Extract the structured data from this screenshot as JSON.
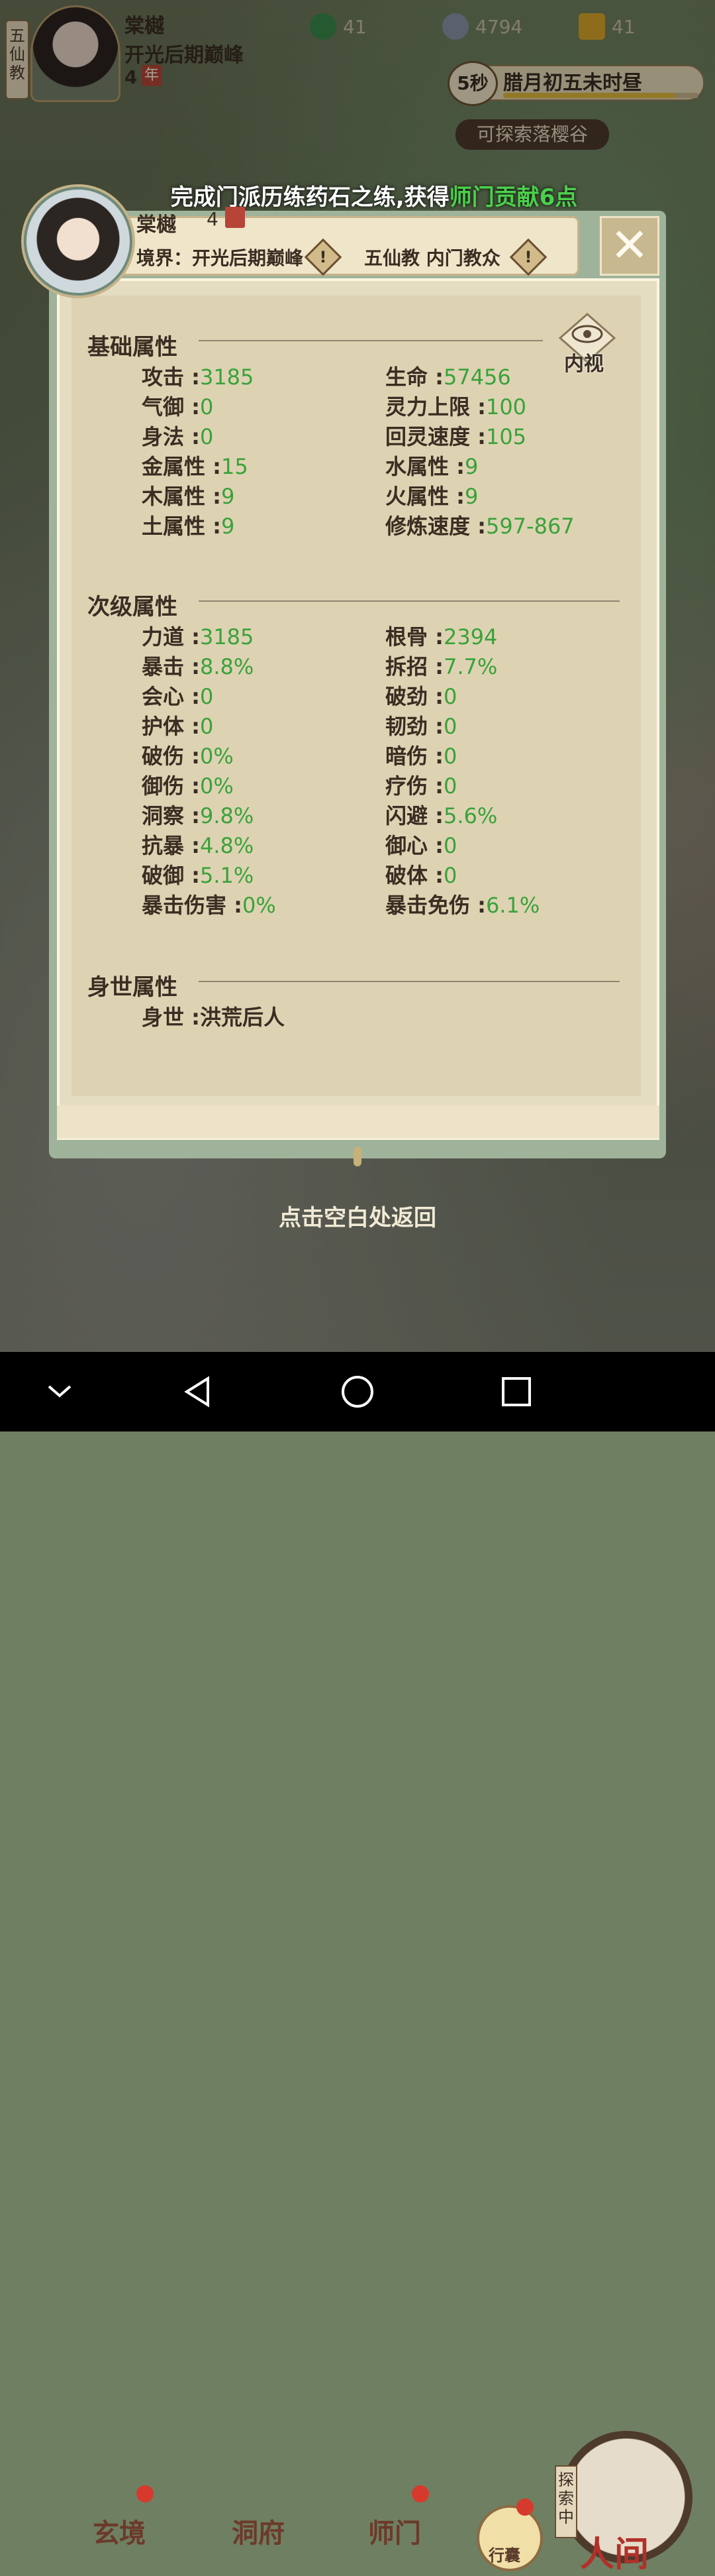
{
  "topbar": {
    "sect_tag": "五仙教",
    "player_name": "棠樾",
    "realm": "开光后期巅峰",
    "age": "4",
    "age_unit": "年",
    "resources": [
      {
        "icon": "jade-coin-icon",
        "value": "41"
      },
      {
        "icon": "silver-coin-icon",
        "value": "4794"
      },
      {
        "icon": "gold-ingot-icon",
        "value": "41"
      }
    ],
    "timer": "5秒",
    "date": "腊月初五未时昼",
    "date_progress": 0.88,
    "explore_hint": "可探索落樱谷"
  },
  "notification": {
    "text": "完成门派历练药石之练,获得",
    "highlight": "师门贡献6点"
  },
  "panel": {
    "header": {
      "name": "棠樾",
      "age": "4",
      "realm": "境界：开光后期巅峰",
      "sect": "五仙教 内门教众"
    },
    "inner_view_label": "内视",
    "basic": {
      "title": "基础属性",
      "stats": [
        {
          "label": "攻击 :",
          "value": "3185"
        },
        {
          "label": "生命 :",
          "value": "57456"
        },
        {
          "label": "气御 :",
          "value": "0"
        },
        {
          "label": "灵力上限 :",
          "value": "100"
        },
        {
          "label": "身法 :",
          "value": "0"
        },
        {
          "label": "回灵速度 :",
          "value": "105"
        },
        {
          "label": "金属性 :",
          "value": "15"
        },
        {
          "label": "水属性 :",
          "value": "9"
        },
        {
          "label": "木属性 :",
          "value": "9"
        },
        {
          "label": "火属性 :",
          "value": "9"
        },
        {
          "label": "土属性 :",
          "value": "9"
        },
        {
          "label": "修炼速度 :",
          "value": "597-867"
        }
      ]
    },
    "secondary": {
      "title": "次级属性",
      "stats": [
        {
          "label": "力道 :",
          "value": "3185"
        },
        {
          "label": "根骨 :",
          "value": "2394"
        },
        {
          "label": "暴击 :",
          "value": "8.8%"
        },
        {
          "label": "拆招 :",
          "value": "7.7%"
        },
        {
          "label": "会心 :",
          "value": "0"
        },
        {
          "label": "破劲 :",
          "value": "0"
        },
        {
          "label": "护体 :",
          "value": "0"
        },
        {
          "label": "韧劲 :",
          "value": "0"
        },
        {
          "label": "破伤 :",
          "value": "0%"
        },
        {
          "label": "暗伤 :",
          "value": "0"
        },
        {
          "label": "御伤 :",
          "value": "0%"
        },
        {
          "label": "疗伤 :",
          "value": "0"
        },
        {
          "label": "洞察 :",
          "value": "9.8%"
        },
        {
          "label": "闪避 :",
          "value": "5.6%"
        },
        {
          "label": "抗暴 :",
          "value": "4.8%"
        },
        {
          "label": "御心 :",
          "value": "0"
        },
        {
          "label": "破御 :",
          "value": "5.1%"
        },
        {
          "label": "破体 :",
          "value": "0"
        },
        {
          "label": "暴击伤害 :",
          "value": "0%"
        },
        {
          "label": "暴击免伤 :",
          "value": "6.1%"
        }
      ]
    },
    "origin": {
      "title": "身世属性",
      "label": "身世 :",
      "value": "洪荒后人"
    }
  },
  "back_hint": "点击空白处返回",
  "game_nav": {
    "items": [
      "玄境",
      "洞府",
      "师门"
    ],
    "bag": "行囊",
    "explore_tag": "探索中",
    "world": "人间"
  },
  "colors": {
    "stat_value": "#3aa23a",
    "highlight": "#4bd04b",
    "badge_red": "#d63a2c"
  }
}
